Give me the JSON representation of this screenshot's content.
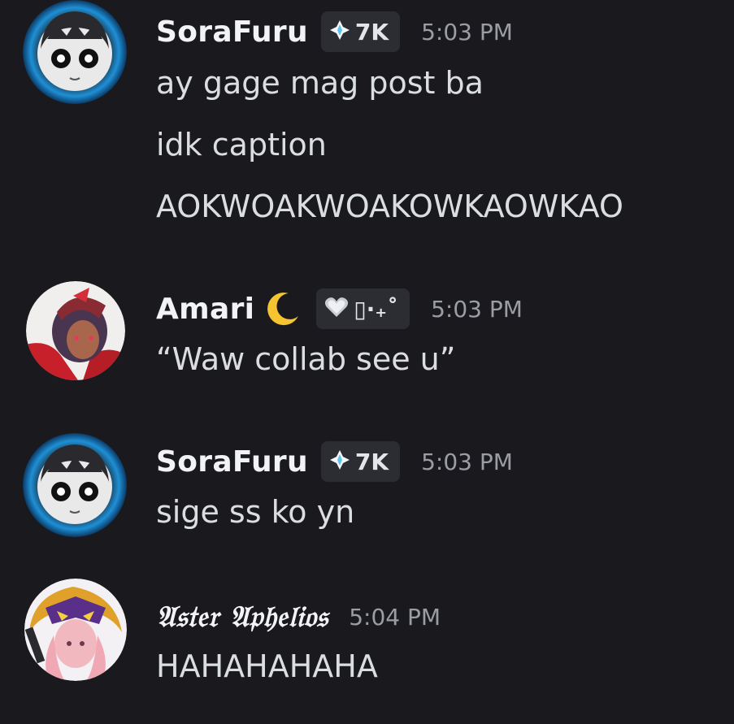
{
  "messages": [
    {
      "username": "SoraFuru",
      "tag": "7K",
      "tag_icon": "sparkle-diamond-icon",
      "time": "5:03 PM",
      "lines": [
        "ay gage mag post ba",
        "idk caption",
        "AOKWOAKWOAKOWKAOWKAO"
      ]
    },
    {
      "username": "Amari",
      "name_emoji": "crescent-moon-icon",
      "tag": "▯·₊˚",
      "tag_icon": "silver-heart-icon",
      "time": "5:03 PM",
      "lines": [
        "“Waw collab see u”"
      ]
    },
    {
      "username": "SoraFuru",
      "tag": "7K",
      "tag_icon": "sparkle-diamond-icon",
      "time": "5:03 PM",
      "lines": [
        "sige ss ko yn"
      ]
    },
    {
      "username": "𝔄𝔰𝔱𝔢𝔯 𝔄𝔭𝔥𝔢𝔩𝔦𝔬𝔰",
      "time": "5:04 PM",
      "lines": [
        "HAHAHAHAHA"
      ]
    }
  ],
  "colors": {
    "background": "#1a1a1e",
    "username": "#f2f3f5",
    "message_text": "#dbdee1",
    "timestamp": "#9a9da4",
    "tag_background": "#2b2d33"
  }
}
